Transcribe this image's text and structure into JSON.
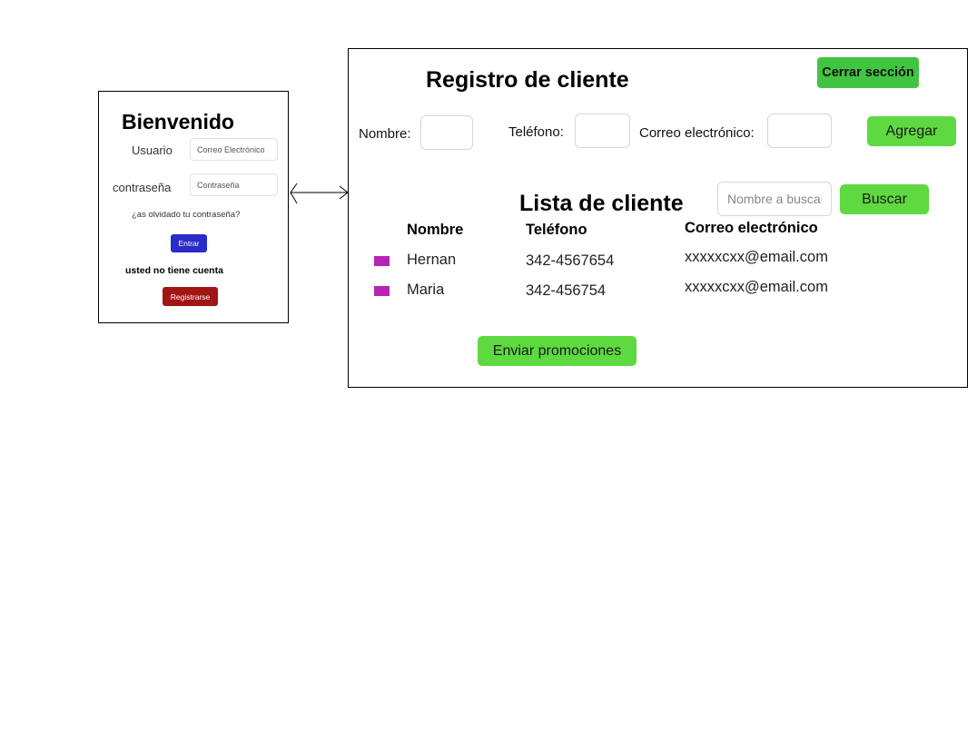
{
  "login": {
    "title": "Bienvenido",
    "user_label": "Usuario",
    "user_placeholder": "Correo Electrónico",
    "password_label": "contraseña",
    "password_placeholder": "Contraseña",
    "forgot_link": "¿as olvidado tu contraseña?",
    "enter_button": "Entrar",
    "no_account_text": "usted no tiene cuenta",
    "register_button": "Registrarse",
    "colors": {
      "enter": "#2b2bc9",
      "register": "#a31414"
    }
  },
  "connector": {
    "icon": "double-arrow-icon"
  },
  "registry": {
    "title": "Registro de cliente",
    "logout_button": "Cerrar sección",
    "name_label": "Nombre:",
    "phone_label": "Teléfono:",
    "email_label": "Correo electrónico:",
    "add_button": "Agregar"
  },
  "client_list": {
    "title": "Lista de cliente",
    "search_placeholder": "Nombre a buscar",
    "search_button": "Buscar",
    "columns": [
      "Nombre",
      "Teléfono",
      "Correo electrónico"
    ],
    "rows": [
      {
        "name": "Hernan",
        "phone": "342-4567654",
        "email": "xxxxxcxx@email.com"
      },
      {
        "name": "Maria",
        "phone": "342-456754",
        "email": "xxxxxcxx@email.com"
      }
    ],
    "promo_button": "Enviar promociones",
    "colors": {
      "green_button": "#5ed940",
      "logout_button": "#41c541",
      "row_marker": "#b623b6"
    }
  }
}
